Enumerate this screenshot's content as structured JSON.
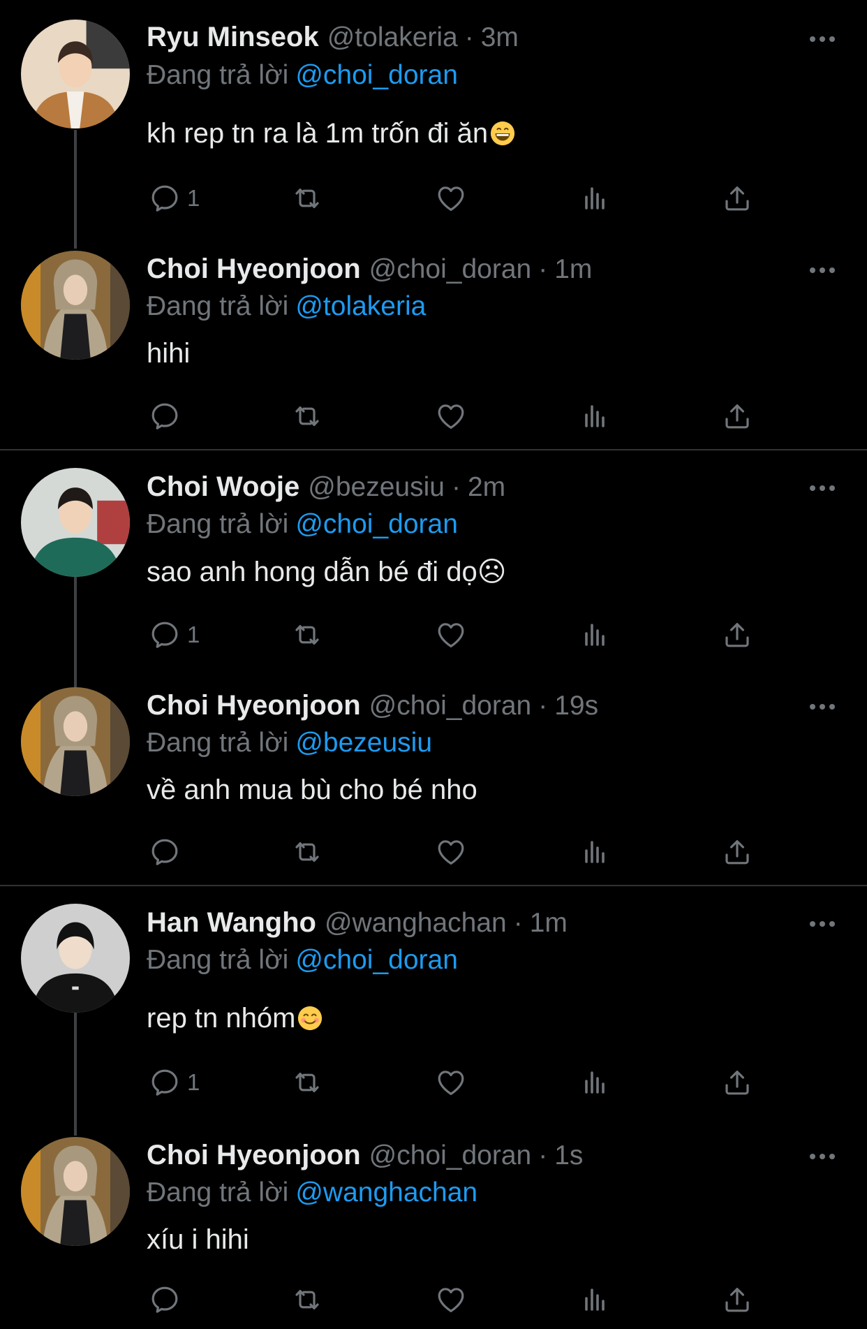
{
  "reply_prefix": "Đang trả lời",
  "colors": {
    "background": "#000000",
    "text": "#e7e9ea",
    "muted": "#71767b",
    "link": "#1d9bf0",
    "divider": "#2f3336"
  },
  "icons": {
    "reply": "reply-icon",
    "retweet": "retweet-icon",
    "like": "heart-icon",
    "views": "views-icon",
    "share": "share-icon",
    "more": "more-icon"
  },
  "tweets": [
    {
      "name": "Ryu Minseok",
      "handle": "@tolakeria",
      "time": "3m",
      "reply_to": "@choi_doran",
      "text": "kh rep tn ra là 1m trốn đi ăn",
      "emoji": "grinning-face",
      "reply_count": "1"
    },
    {
      "name": "Choi Hyeonjoon",
      "handle": "@choi_doran",
      "time": "1m",
      "reply_to": "@tolakeria",
      "text": "hihi",
      "emoji": "",
      "reply_count": ""
    },
    {
      "name": "Choi Wooje",
      "handle": "@bezeusiu",
      "time": "2m",
      "reply_to": "@choi_doran",
      "text": "sao anh hong dẫn bé đi dọ☹",
      "emoji": "",
      "reply_count": "1"
    },
    {
      "name": "Choi Hyeonjoon",
      "handle": "@choi_doran",
      "time": "19s",
      "reply_to": "@bezeusiu",
      "text": "về anh mua bù cho bé nho",
      "emoji": "",
      "reply_count": ""
    },
    {
      "name": "Han Wangho",
      "handle": "@wanghachan",
      "time": "1m",
      "reply_to": "@choi_doran",
      "text": "rep tn nhóm",
      "emoji": "smiling-face",
      "reply_count": "1"
    },
    {
      "name": "Choi Hyeonjoon",
      "handle": "@choi_doran",
      "time": "1s",
      "reply_to": "@wanghachan",
      "text": "xíu i hihi",
      "emoji": "",
      "reply_count": ""
    }
  ]
}
